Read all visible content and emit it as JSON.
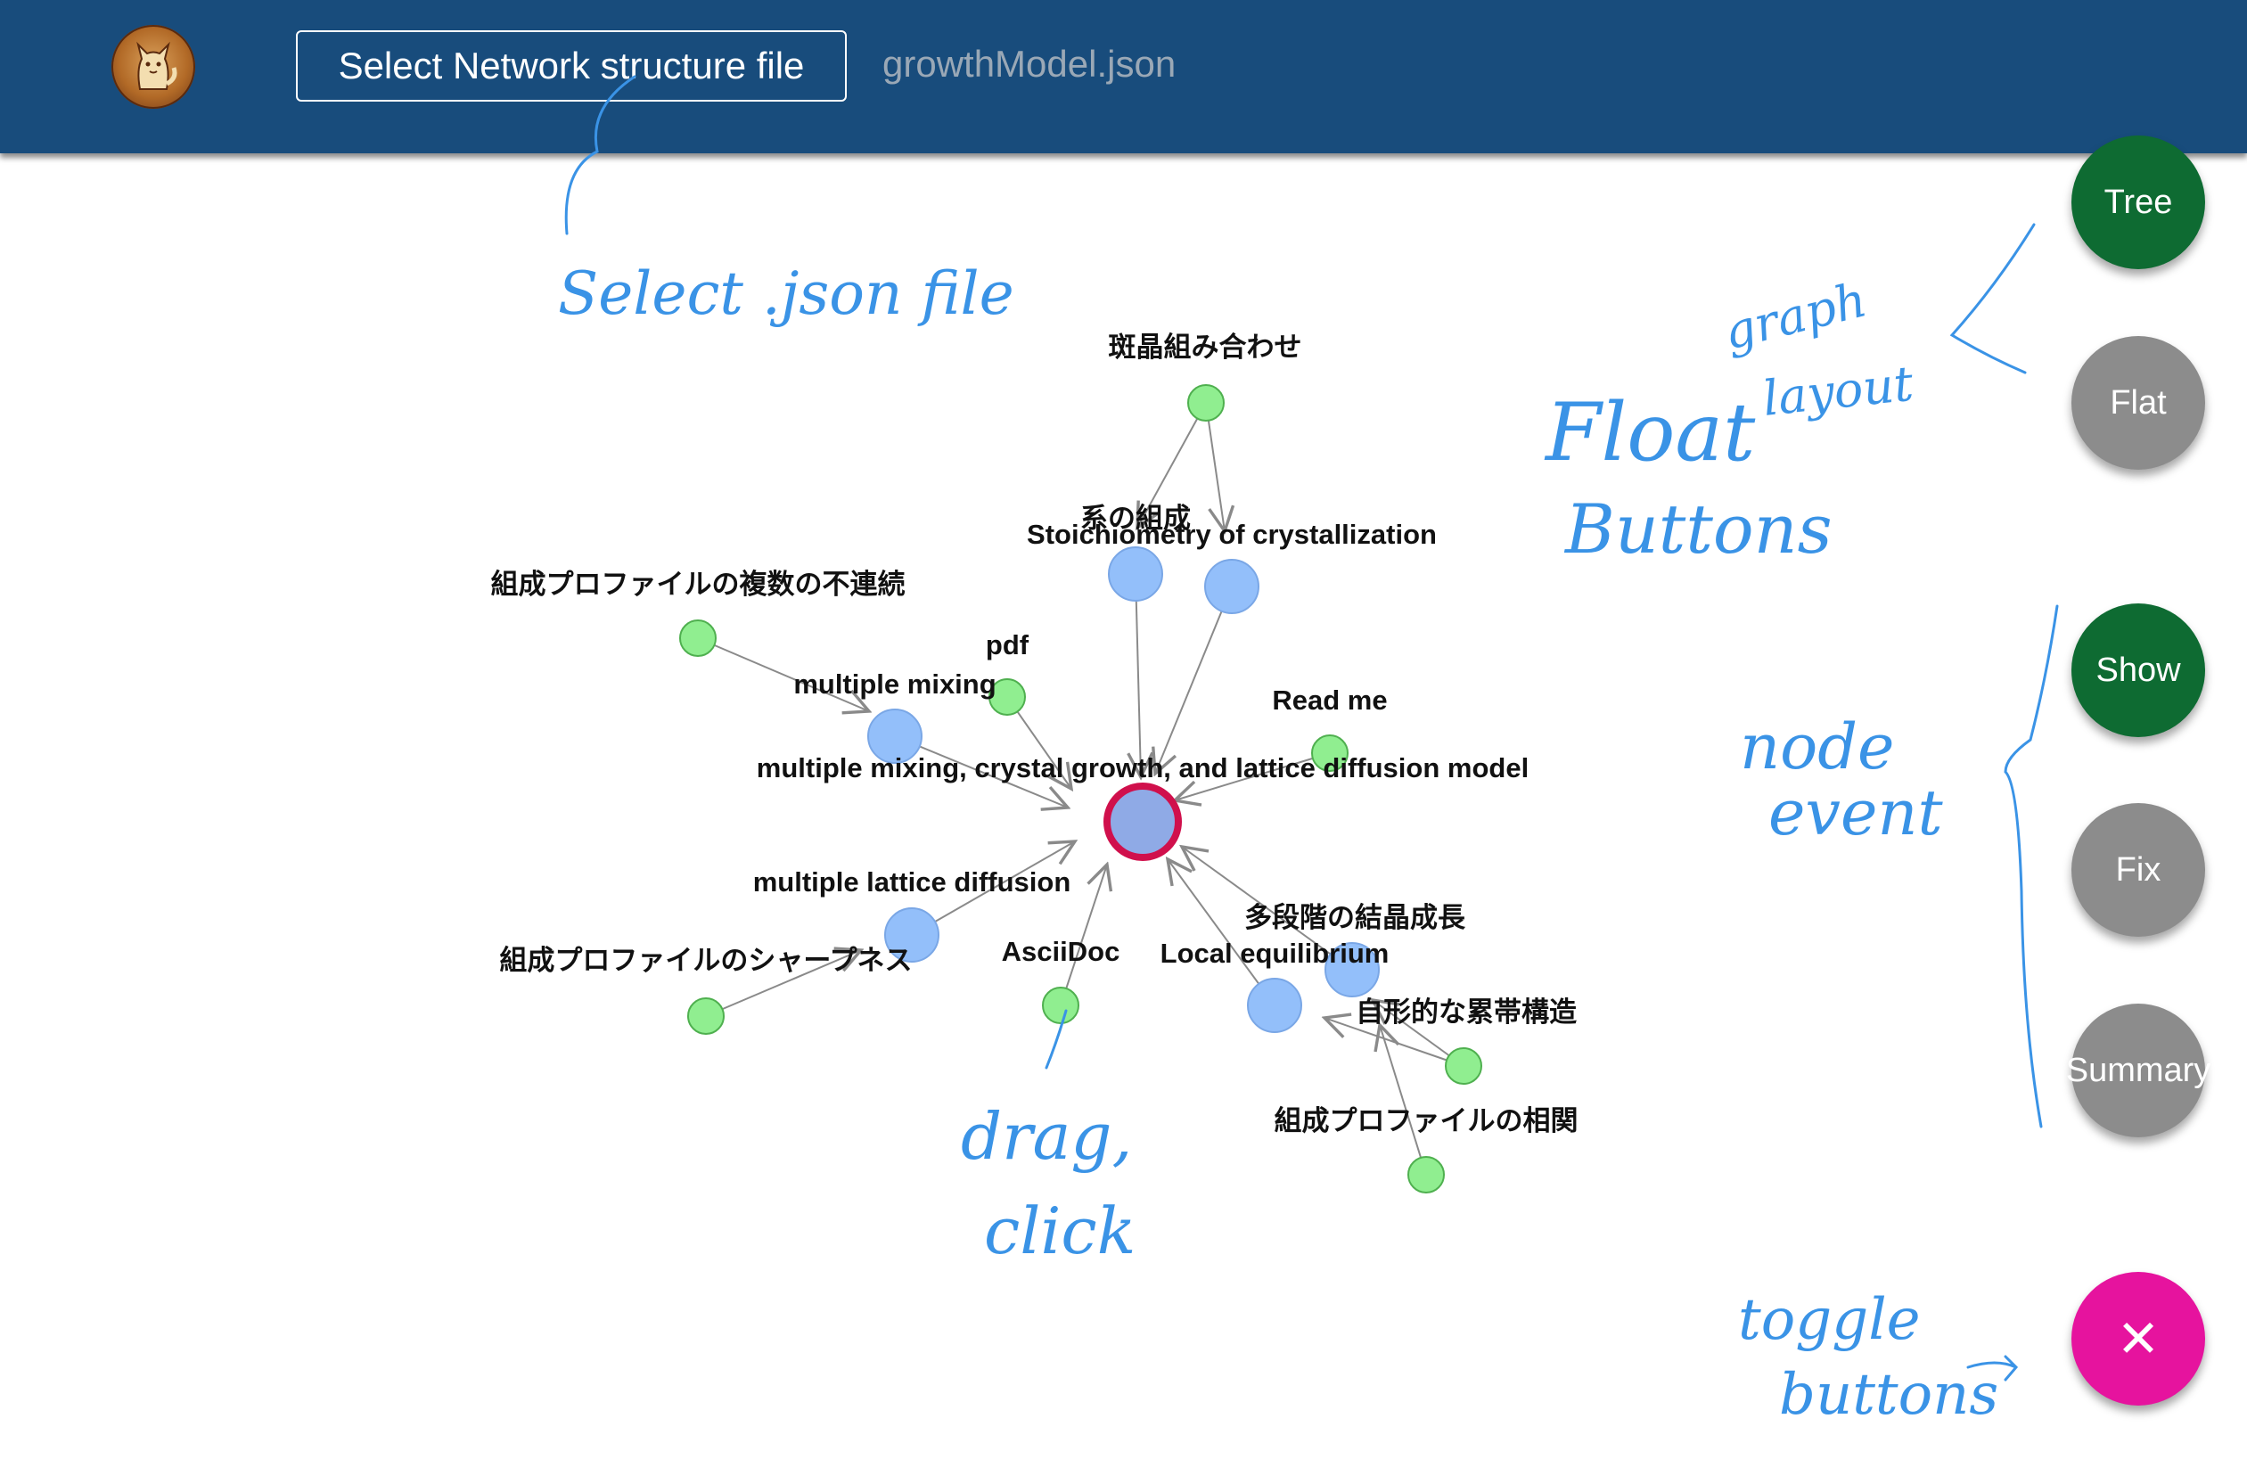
{
  "header": {
    "select_button_label": "Select Network structure file",
    "file_name": "growthModel.json"
  },
  "fabs": {
    "tree": "Tree",
    "flat": "Flat",
    "show": "Show",
    "fix": "Fix",
    "summary": "Summary",
    "toggle": "✕"
  },
  "graph": {
    "center_label": "multiple mixing, crystal growth, and lattice diffusion model",
    "nodes": {
      "hanshou": "斑晶組み合わせ",
      "kei_no_sosei": "系の組成",
      "stoichiometry": "Stoichiometry of crystallization",
      "fuzoku": "組成プロファイルの複数の不連続",
      "pdf": "pdf",
      "multiple_mixing": "multiple mixing",
      "read_me": "Read me",
      "lattice_diffusion": "multiple lattice diffusion",
      "sharpness": "組成プロファイルのシャープネス",
      "asciidoc": "AsciiDoc",
      "local_eq": "Local equilibrium",
      "tadankai": "多段階の結晶成長",
      "jikei": "自形的な累帯構造",
      "soukan": "組成プロファイルの相関"
    }
  },
  "annotations": {
    "select_json": "Select .json file",
    "graph_layout_1": "graph",
    "graph_layout_2": "layout",
    "float_buttons_1": "Float",
    "float_buttons_2": "Buttons",
    "node_event_1": "node",
    "node_event_2": "event",
    "drag_click_1": "drag,",
    "drag_click_2": "click",
    "toggle_buttons_1": "toggle",
    "toggle_buttons_2": "buttons"
  },
  "colors": {
    "header_bg": "#184c7c",
    "concept_node": "#93bffa",
    "leaf_node": "#90ee90",
    "center_node_stroke": "#d0104c",
    "fab_green": "#0e6b32",
    "fab_gray": "#8c8c8c",
    "fab_pink": "#e6139e",
    "annotation_ink": "#3a93e6"
  },
  "icons": {
    "avatar": "cat-avatar-icon",
    "toggle": "close-icon"
  }
}
